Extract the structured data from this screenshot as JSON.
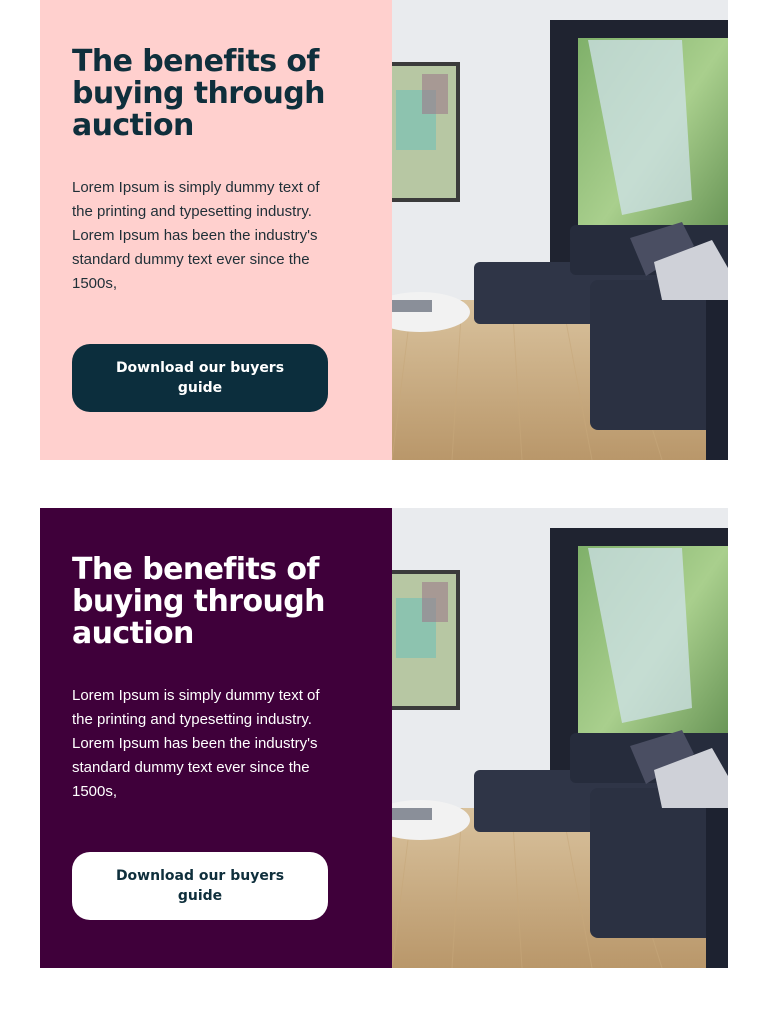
{
  "cards": [
    {
      "title": "The benefits of buying through auction",
      "body": "Lorem Ipsum is simply dummy text of the printing and typesetting industry. Lorem Ipsum has been the industry's standard dummy text ever since the 1500s,",
      "cta_label": "Download our buyers guide",
      "background": "#ffd0ce"
    },
    {
      "title": "The benefits of buying through auction",
      "body": "Lorem Ipsum is simply dummy text of the printing and typesetting industry. Lorem Ipsum has been the industry's standard dummy text ever since the 1500s,",
      "cta_label": "Download our buyers guide",
      "background": "#3f003a"
    }
  ],
  "colors": {
    "navy": "#0c2e3d",
    "plum": "#3f003a",
    "pink": "#ffd0ce",
    "white": "#ffffff"
  }
}
